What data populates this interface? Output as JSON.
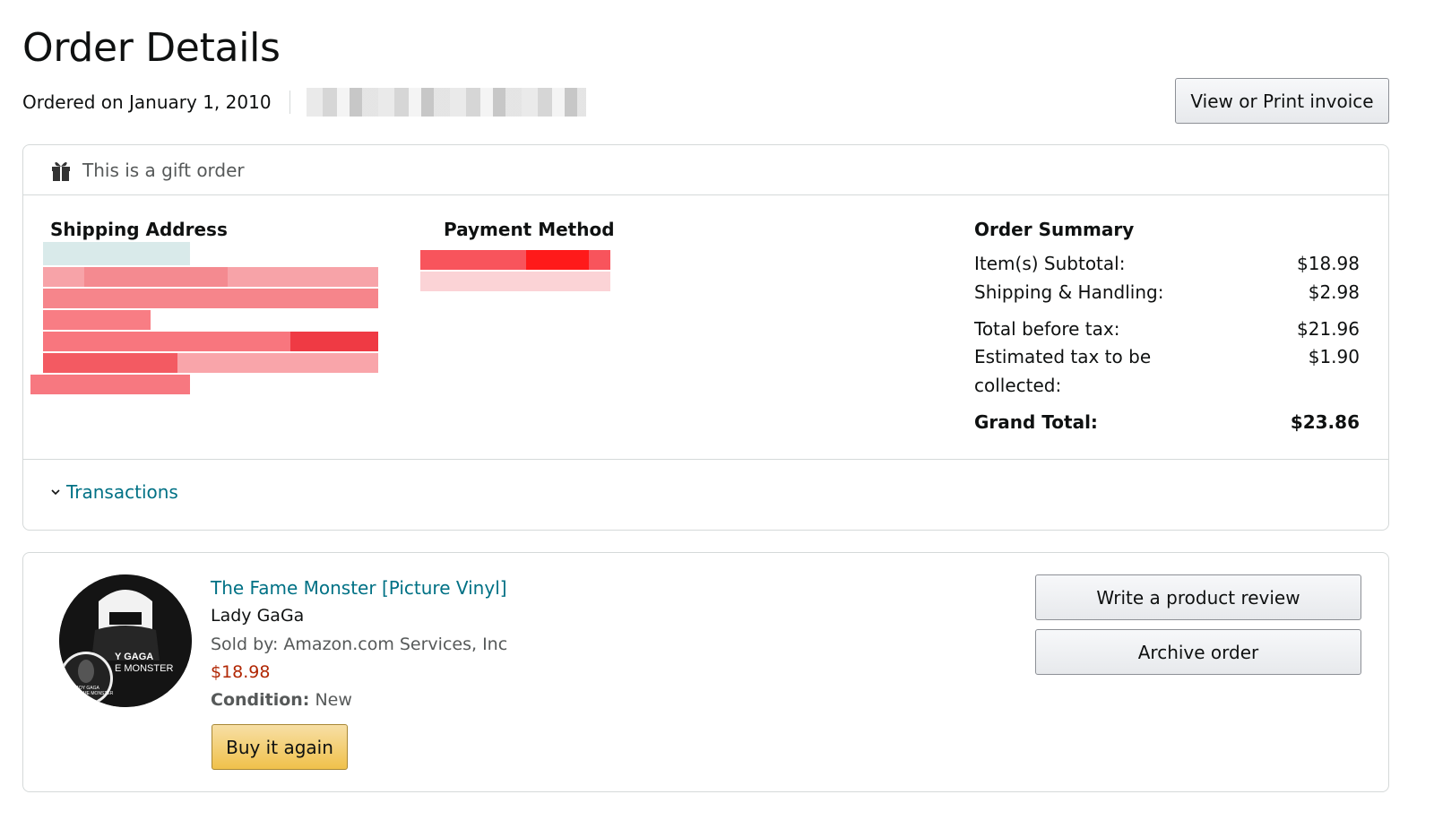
{
  "page": {
    "title": "Order Details",
    "ordered_on": "Ordered on January 1, 2010",
    "invoice_button": "View or Print invoice"
  },
  "gift": {
    "label": "This is a gift order",
    "icon": "gift-icon"
  },
  "shipping": {
    "heading": "Shipping Address"
  },
  "payment": {
    "heading": "Payment Method"
  },
  "summary": {
    "heading": "Order Summary",
    "rows": [
      {
        "label": "Item(s) Subtotal:",
        "value": "$18.98"
      },
      {
        "label": "Shipping & Handling:",
        "value": "$2.98"
      },
      {
        "label": "Total before tax:",
        "value": "$21.96"
      },
      {
        "label": "Estimated tax to be collected:",
        "value": "$1.90"
      }
    ],
    "grand_total": {
      "label": "Grand Total:",
      "value": "$23.86"
    }
  },
  "transactions": {
    "label": "Transactions",
    "icon": "chevron-down-icon"
  },
  "item": {
    "title": "The Fame Monster [Picture Vinyl]",
    "artist": "Lady GaGa",
    "sold_by": "Sold by: Amazon.com Services, Inc",
    "price": "$18.98",
    "condition_label": "Condition:",
    "condition_value": "New",
    "buy_again": "Buy it again",
    "album_text_1": "Y GAGA",
    "album_text_2": "E MONSTER",
    "album_small_1": "LADY GAGA",
    "album_small_2": "THE FAME MONSTER"
  },
  "actions": {
    "write_review": "Write a product review",
    "archive": "Archive order"
  },
  "colors": {
    "link": "#007185",
    "price": "#b12704",
    "buy_button": "#f0c14b",
    "border": "#d5d9d9"
  }
}
